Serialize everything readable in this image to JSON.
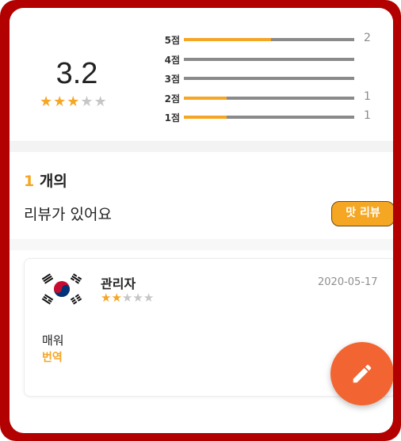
{
  "summary": {
    "average": "3.2",
    "average_stars": 3,
    "rows": [
      {
        "label": "5점",
        "fraction": 0.51,
        "count": "2"
      },
      {
        "label": "4점",
        "fraction": 0,
        "count": ""
      },
      {
        "label": "3점",
        "fraction": 0,
        "count": ""
      },
      {
        "label": "2점",
        "fraction": 0.25,
        "count": "1"
      },
      {
        "label": "1점",
        "fraction": 0.25,
        "count": "1"
      }
    ]
  },
  "review_count": {
    "number": "1",
    "unit": " 개의",
    "subtitle": "리뷰가 있어요",
    "taste_button": "맛 리뷰"
  },
  "review": {
    "author": "관리자",
    "stars": 2,
    "date": "2020-05-17",
    "text": "매워",
    "translate_label": "번역",
    "avatar": "korea-flag-icon"
  },
  "colors": {
    "accent": "#f5a623",
    "fab": "#f26532",
    "frame": "#b30000"
  },
  "icons": {
    "fab": "pencil-icon",
    "star": "star-icon"
  }
}
